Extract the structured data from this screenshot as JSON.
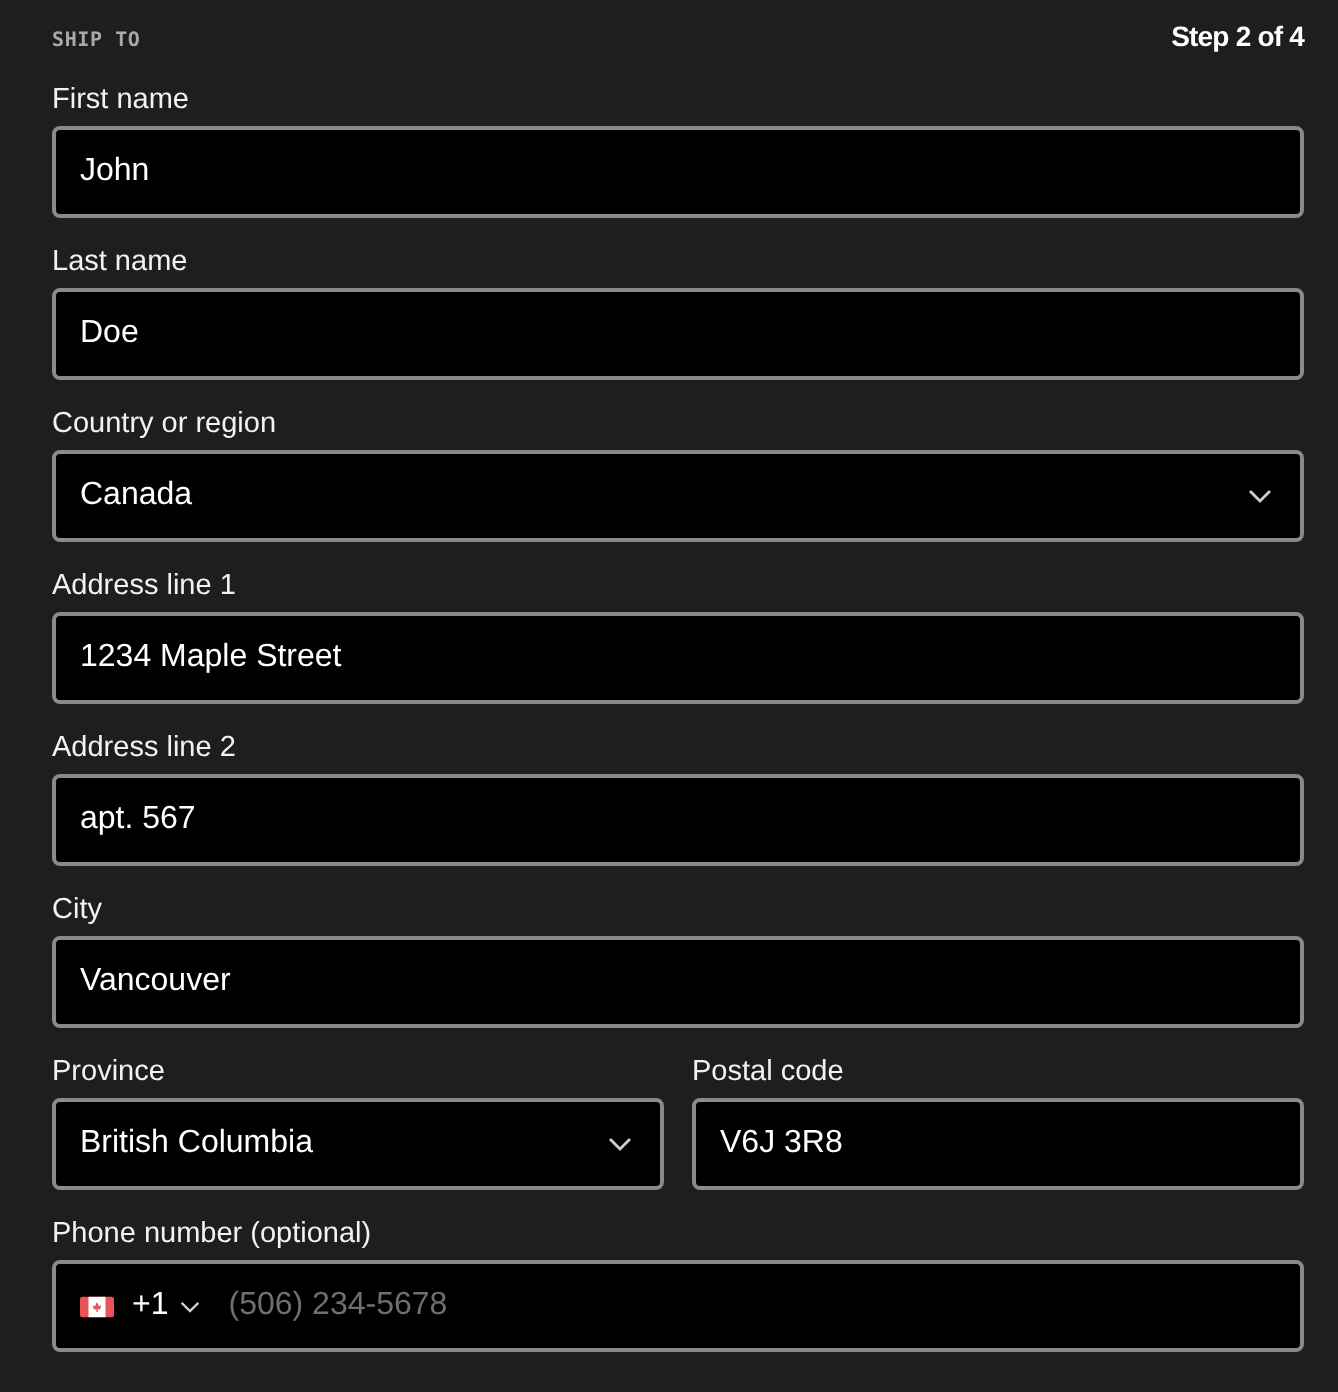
{
  "section_title": "SHIP TO",
  "step": "Step 2 of 4",
  "rows": [
    [
      {
        "label": "First name",
        "kind": "text",
        "value": "John"
      }
    ],
    [
      {
        "label": "Last name",
        "kind": "text",
        "value": "Doe"
      }
    ],
    [
      {
        "label": "Country or region",
        "kind": "select",
        "value": "Canada"
      }
    ],
    [
      {
        "label": "Address line 1",
        "kind": "text",
        "value": "1234 Maple Street"
      }
    ],
    [
      {
        "label": "Address line 2",
        "kind": "text",
        "value": "apt. 567"
      }
    ],
    [
      {
        "label": "City",
        "kind": "text",
        "value": "Vancouver"
      }
    ],
    [
      {
        "label": "Province",
        "kind": "select",
        "value": "British Columbia"
      },
      {
        "label": "Postal code",
        "kind": "text",
        "value": "V6J 3R8"
      }
    ],
    [
      {
        "label": "Phone number (optional)",
        "kind": "phone",
        "code": "+1",
        "placeholder": "(506) 234-5678"
      }
    ]
  ]
}
